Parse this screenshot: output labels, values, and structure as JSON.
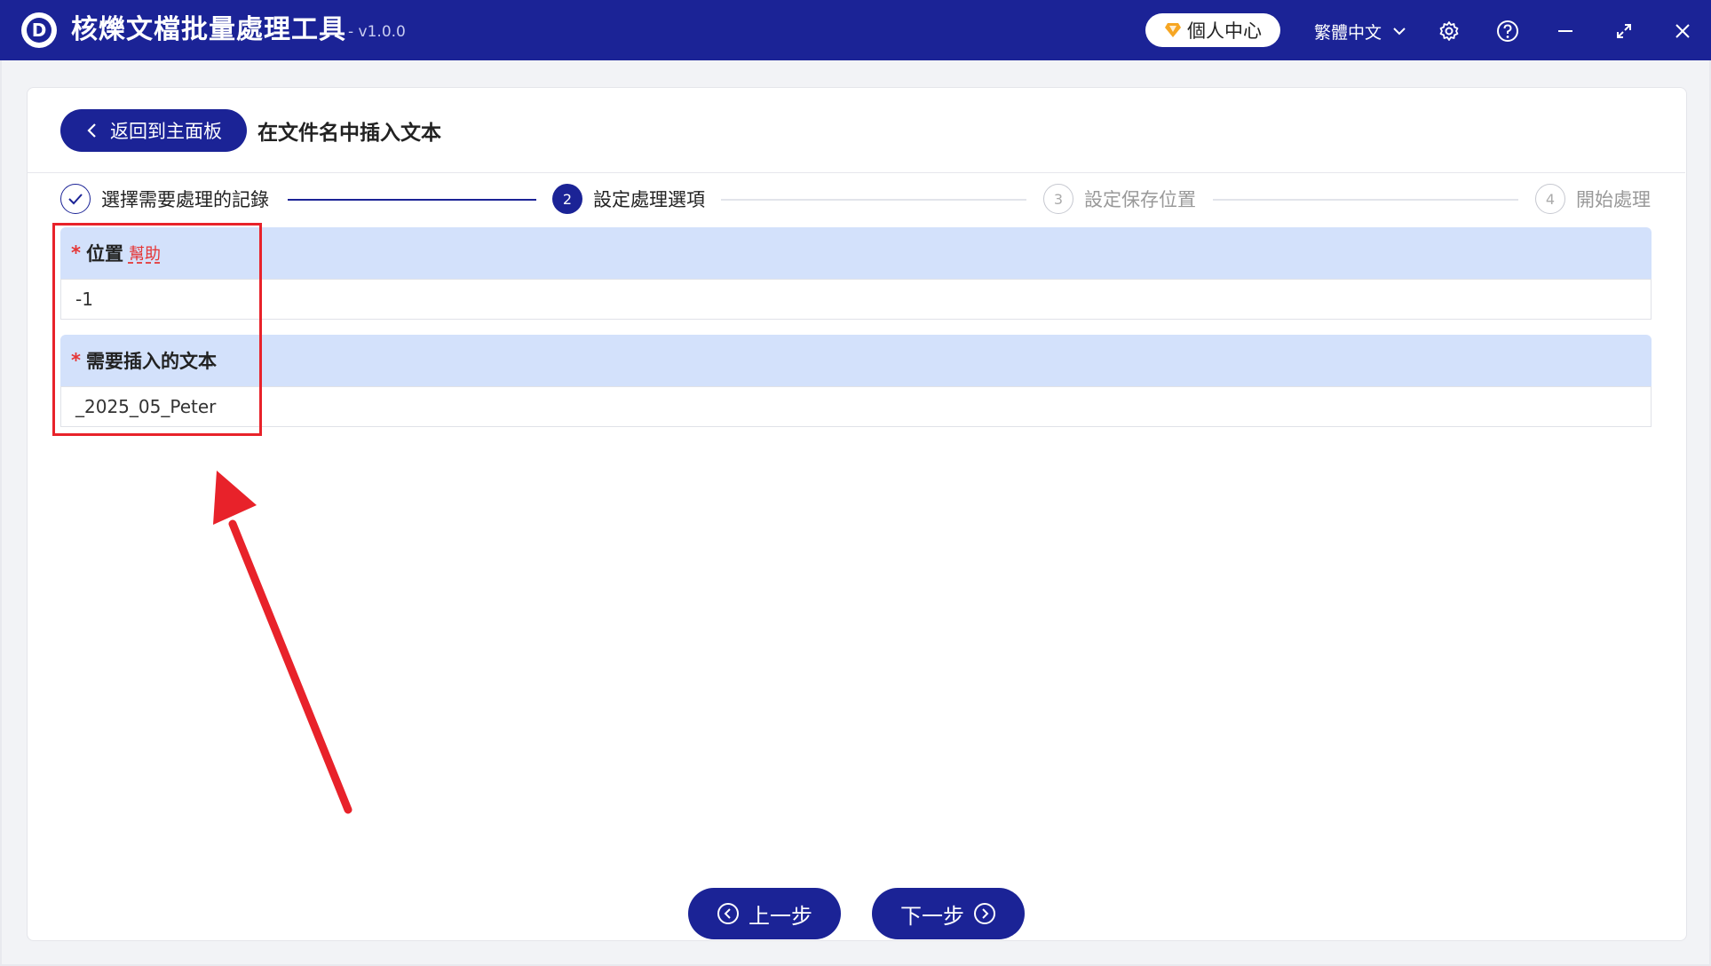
{
  "app": {
    "logo_letter": "D",
    "title": "核爍文檔批量處理工具",
    "version": "- v1.0.0",
    "vip_label": "個人中心",
    "language": "繁體中文"
  },
  "header": {
    "back_label": "返回到主面板",
    "page_title": "在文件名中插入文本"
  },
  "steps": [
    {
      "number": "",
      "label": "選擇需要處理的記錄",
      "state": "done"
    },
    {
      "number": "2",
      "label": "設定處理選項",
      "state": "active"
    },
    {
      "number": "3",
      "label": "設定保存位置",
      "state": "pending"
    },
    {
      "number": "4",
      "label": "開始處理",
      "state": "pending"
    }
  ],
  "form": {
    "position": {
      "required_mark": "*",
      "label": "位置",
      "help": "幫助",
      "value": "-1"
    },
    "insert_text": {
      "required_mark": "*",
      "label": "需要插入的文本",
      "value": "_2025_05_Peter"
    }
  },
  "footer": {
    "prev_label": "上一步",
    "next_label": "下一步"
  },
  "colors": {
    "brand": "#1b2396",
    "section_header": "#d3e1fb",
    "annotation": "#e8222a"
  }
}
